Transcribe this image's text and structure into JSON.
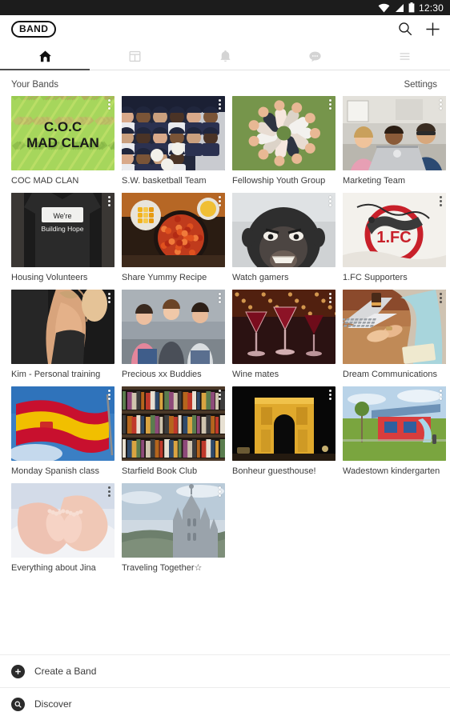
{
  "status_bar": {
    "time": "12:30",
    "icons": [
      "wifi-icon",
      "signal-icon",
      "battery-icon"
    ]
  },
  "app_bar": {
    "logo_text": "BAND",
    "actions": [
      {
        "name": "search-icon",
        "label": "Search"
      },
      {
        "name": "add-icon",
        "label": "Add"
      }
    ]
  },
  "tabs": [
    {
      "id": "home",
      "icon": "home-icon",
      "active": true
    },
    {
      "id": "feed",
      "icon": "news-icon",
      "active": false
    },
    {
      "id": "notifications",
      "icon": "bell-icon",
      "active": false
    },
    {
      "id": "chats",
      "icon": "chat-bubble-icon",
      "active": false
    },
    {
      "id": "more",
      "icon": "hamburger-menu-icon",
      "active": false
    }
  ],
  "section": {
    "title": "Your Bands",
    "action": "Settings"
  },
  "bands": [
    {
      "name": "COC MAD CLAN",
      "thumb": "coc-mad-clan",
      "dots": "light"
    },
    {
      "name": "S.W. basketball Team",
      "thumb": "basketball-team",
      "dots": "light"
    },
    {
      "name": "Fellowship Youth Group",
      "thumb": "youth-circle-grass",
      "dots": "light"
    },
    {
      "name": "Marketing Team",
      "thumb": "office-meeting",
      "dots": "light"
    },
    {
      "name": "Housing Volunteers",
      "thumb": "building-hope-shirt",
      "dots": "light"
    },
    {
      "name": "Share Yummy Recipe",
      "thumb": "food-bowls",
      "dots": "light"
    },
    {
      "name": "Watch gamers",
      "thumb": "gorilla-game",
      "dots": "light"
    },
    {
      "name": "1.FC Supporters",
      "thumb": "fc-crest",
      "dots": "dark"
    },
    {
      "name": "Kim - Personal training",
      "thumb": "fitness-back",
      "dots": "light"
    },
    {
      "name": "Precious xx Buddies",
      "thumb": "friends-group",
      "dots": "light"
    },
    {
      "name": "Wine mates",
      "thumb": "wine-glasses",
      "dots": "light"
    },
    {
      "name": "Dream Communications",
      "thumb": "laptop-desk",
      "dots": "dark"
    },
    {
      "name": "Monday Spanish class",
      "thumb": "spanish-flag",
      "dots": "light"
    },
    {
      "name": "Starfield Book Club",
      "thumb": "bookshelf",
      "dots": "light"
    },
    {
      "name": "Bonheur guesthouse!",
      "thumb": "arc-de-triomphe",
      "dots": "light"
    },
    {
      "name": "Wadestown kindergarten",
      "thumb": "kindergarten",
      "dots": "light"
    },
    {
      "name": "Everything about Jina",
      "thumb": "baby-feet",
      "dots": "dark"
    },
    {
      "name": "Traveling Together☆",
      "thumb": "cathedral",
      "dots": "light"
    }
  ],
  "bottom_actions": [
    {
      "label": "Create a Band",
      "icon": "plus-circle-icon"
    },
    {
      "label": "Discover",
      "icon": "search-circle-icon"
    }
  ],
  "colors": {
    "status_bar_bg": "#1c1c1c",
    "accent_underline": "#4d4d4d",
    "text_primary": "#3c3c3c",
    "inactive_icon": "#d0d0d0"
  }
}
